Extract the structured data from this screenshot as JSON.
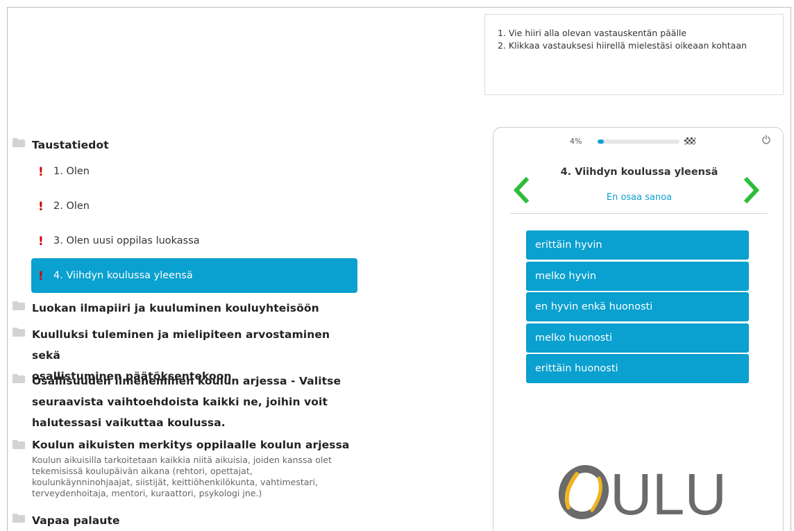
{
  "instructions": {
    "line1": "1. Vie hiiri alla olevan vastauskentän päälle",
    "line2": "2. Klikkaa vastauksesi hiirellä mielestäsi oikeaan kohtaan"
  },
  "tree": {
    "section1": {
      "title": "Taustatiedot"
    },
    "questions": [
      {
        "marker": "!",
        "label": "1. Olen"
      },
      {
        "marker": "!",
        "label": "2. Olen"
      },
      {
        "marker": "!",
        "label": "3. Olen uusi oppilas luokassa"
      },
      {
        "marker": "!",
        "label": "4. Viihdyn koulussa yleensä"
      }
    ],
    "section2": {
      "title": "Luokan ilmapiiri ja kuuluminen kouluyhteisöön"
    },
    "section3": {
      "title_line1": "Kuulluksi tuleminen ja mielipiteen arvostaminen sekä",
      "title_line2": "osallistuminen päätöksentekoon"
    },
    "section4": {
      "title_line1": "Osallisuuden ilmeneminen koulun arjessa - Valitse",
      "title_line2": "seuraavista vaihtoehdoista kaikki ne, joihin voit",
      "title_line3": "halutessasi vaikuttaa koulussa."
    },
    "section5": {
      "title": "Koulun aikuisten merkitys oppilaalle koulun arjessa",
      "desc_line1": "Koulun aikuisilla tarkoitetaan kaikkia niitä aikuisia, joiden kanssa olet",
      "desc_line2": "tekemisissä koulupäivän aikana (rehtori, opettajat,",
      "desc_line3": "koulunkäynninohjaajat, siistijät, keittiöhenkilökunta, vahtimestari,",
      "desc_line4": "terveydenhoitaja, mentori, kuraattori, psykologi jne.)"
    },
    "section6": {
      "title": "Vapaa palaute"
    }
  },
  "panel": {
    "progress_label": "4%",
    "progress_value": 0.04,
    "question_title": "4. Viihdyn koulussa yleensä",
    "current_answer": "En osaa sanoa",
    "answers": [
      "erittäin hyvin",
      "melko hyvin",
      "en hyvin enkä huonosti",
      "melko huonosti",
      "erittäin huonosti"
    ],
    "logo_text": "ULU"
  },
  "colors": {
    "accent": "#0aa0cf",
    "nav_arrow": "#2ebd3a",
    "required_marker": "#d50000",
    "logo_gray": "#6b6b6b",
    "logo_gold": "#f0b422"
  },
  "icons": [
    "folder-icon",
    "exclamation-icon",
    "chevron-left-icon",
    "chevron-right-icon",
    "checkered-flag-icon",
    "power-icon"
  ]
}
